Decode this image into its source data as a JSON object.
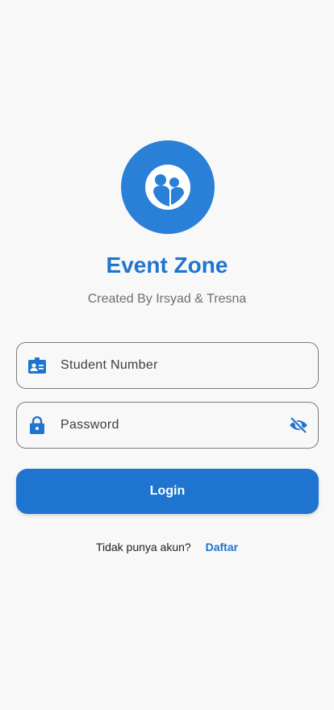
{
  "app": {
    "title": "Event Zone",
    "subtitle": "Created By Irsyad & Tresna"
  },
  "form": {
    "student_number": {
      "placeholder": "Student Number",
      "value": "",
      "icon": "badge-icon"
    },
    "password": {
      "placeholder": "Password",
      "value": "",
      "icon": "lock-icon",
      "toggle_icon": "visibility-off-icon"
    },
    "login_label": "Login"
  },
  "signup": {
    "prompt": "Tidak punya akun?",
    "link": "Daftar"
  },
  "colors": {
    "primary": "#1f74d0",
    "logo_bg": "#2a7fd6",
    "background": "#f8f8f9",
    "subtitle": "#6f6f6f",
    "border": "#7b7b7b"
  }
}
